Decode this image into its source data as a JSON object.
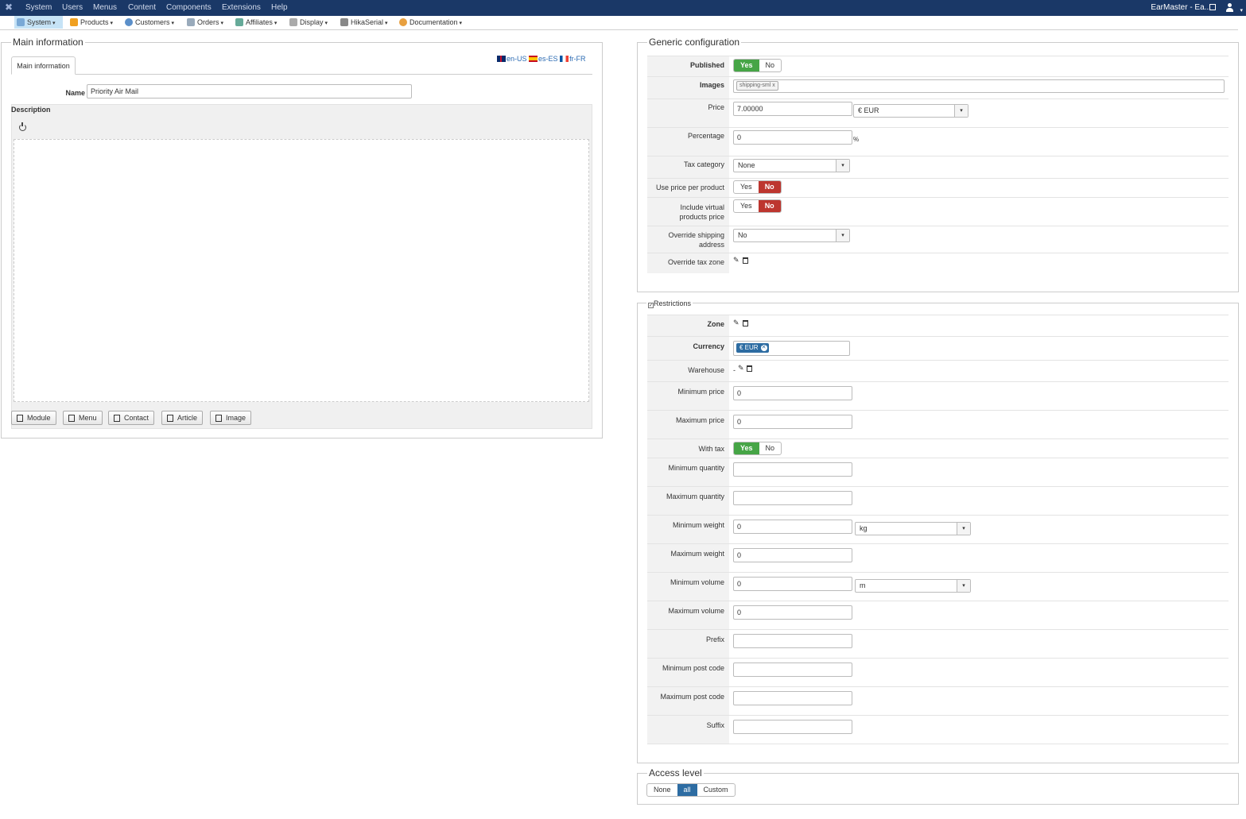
{
  "topbar": {
    "menus": [
      "System",
      "Users",
      "Menus",
      "Content",
      "Components",
      "Extensions",
      "Help"
    ],
    "site": "EarMaster - Ea..."
  },
  "hikabar": {
    "items": [
      "System",
      "Products",
      "Customers",
      "Orders",
      "Affiliates",
      "Display",
      "HikaSerial",
      "Documentation"
    ]
  },
  "main": {
    "legend": "Main information",
    "tab": "Main information",
    "langs": [
      "en-US",
      "es-ES",
      "fr-FR"
    ],
    "name_label": "Name",
    "name_value": "Priority Air Mail",
    "description_label": "Description",
    "buttons": [
      "Module",
      "Menu",
      "Contact",
      "Article",
      "Image"
    ]
  },
  "generic": {
    "legend": "Generic configuration",
    "published_label": "Published",
    "yes": "Yes",
    "no": "No",
    "images_label": "Images",
    "image_tag": "shipping-sml",
    "price_label": "Price",
    "price_value": "7.00000",
    "currency_value": "€ EUR",
    "percentage_label": "Percentage",
    "percentage_value": "0",
    "percent_sign": "%",
    "tax_category_label": "Tax category",
    "tax_category_value": "None",
    "use_price_label": "Use price per product",
    "include_virtual_label_1": "Include virtual",
    "include_virtual_label_2": "products price",
    "override_shipping_label_1": "Override shipping",
    "override_shipping_label_2": "address",
    "override_shipping_value": "No",
    "override_tax_label": "Override tax zone"
  },
  "restrictions": {
    "legend": "Restrictions",
    "zone_label": "Zone",
    "currency_label": "Currency",
    "currency_badge": "€ EUR",
    "warehouse_label": "Warehouse",
    "warehouse_value": "-",
    "min_price_label": "Minimum price",
    "min_price_value": "0",
    "max_price_label": "Maximum price",
    "max_price_value": "0",
    "with_tax_label": "With tax",
    "min_qty_label": "Minimum quantity",
    "max_qty_label": "Maximum quantity",
    "min_weight_label": "Minimum weight",
    "min_weight_value": "0",
    "weight_unit": "kg",
    "max_weight_label": "Maximum weight",
    "max_weight_value": "0",
    "min_volume_label": "Minimum volume",
    "min_volume_value": "0",
    "volume_unit": "m",
    "max_volume_label": "Maximum volume",
    "max_volume_value": "0",
    "prefix_label": "Prefix",
    "min_post_label": "Minimum post code",
    "max_post_label": "Maximum post code",
    "suffix_label": "Suffix"
  },
  "access": {
    "legend": "Access level",
    "options": [
      "None",
      "all",
      "Custom"
    ]
  },
  "colors": {
    "topbar": "#1a3867",
    "yes_active": "#46a546",
    "no_active": "#bd362f",
    "selected_blue": "#2d6ca2"
  }
}
